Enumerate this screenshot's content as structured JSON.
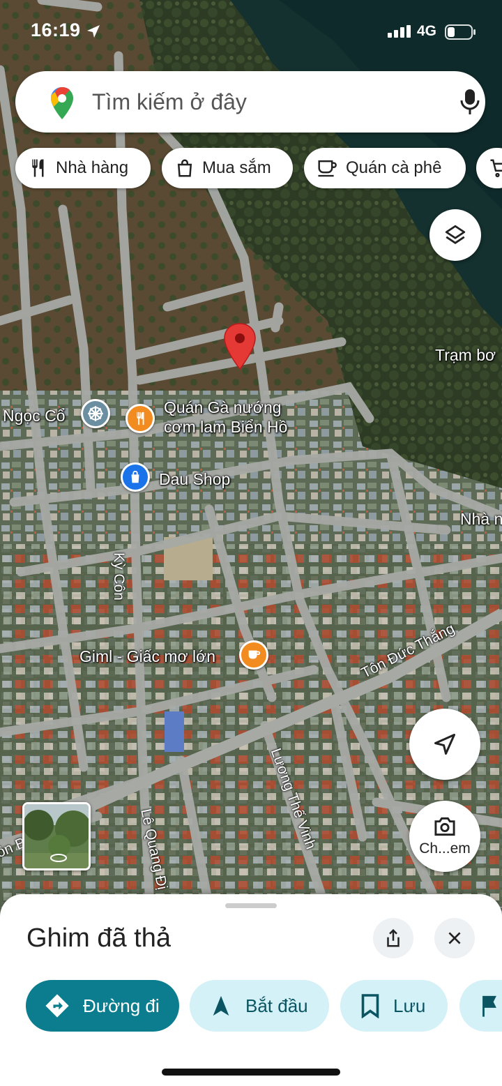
{
  "status_bar": {
    "time": "16:19",
    "network": "4G"
  },
  "search": {
    "placeholder": "Tìm kiếm ở đây"
  },
  "chips": [
    {
      "label": "Nhà hàng",
      "icon": "restaurant-icon"
    },
    {
      "label": "Mua sắm",
      "icon": "shopping-bag-icon"
    },
    {
      "label": "Quán cà phê",
      "icon": "coffee-icon"
    },
    {
      "label": "",
      "icon": "cart-icon"
    }
  ],
  "map": {
    "places": {
      "tram_bom": "Trạm bơ",
      "ngoc_co": "Ngọc Cổ",
      "quan_ga_line1": "Quán Gà nướng",
      "quan_ga_line2": "cơm lam Biển Hồ",
      "dau_shop": "Dau Shop",
      "nha": "Nhà n",
      "giml": "Giml - Giấc mơ lớn"
    },
    "roads": {
      "ky_con": "Kỳ Côn",
      "ton_duc_thang": "Tôn Đức Thắng",
      "luong_the_vinh": "Lương Thế Vinh",
      "le_quang_dinh": "Lê Quang Đị",
      "ton_b": "ôn B"
    }
  },
  "controls": {
    "camera_label": "Ch...em"
  },
  "sheet": {
    "title": "Ghim đã thả",
    "actions": {
      "directions": "Đường đi",
      "start": "Bắt đầu",
      "save": "Lưu"
    }
  },
  "colors": {
    "primary_teal": "#0b7d8e",
    "secondary_bg": "#d3f1f6",
    "pin_red": "#e53935",
    "poi_orange": "#f28b20",
    "poi_blue": "#1a73e8",
    "poi_gray": "#6b8ea0"
  }
}
